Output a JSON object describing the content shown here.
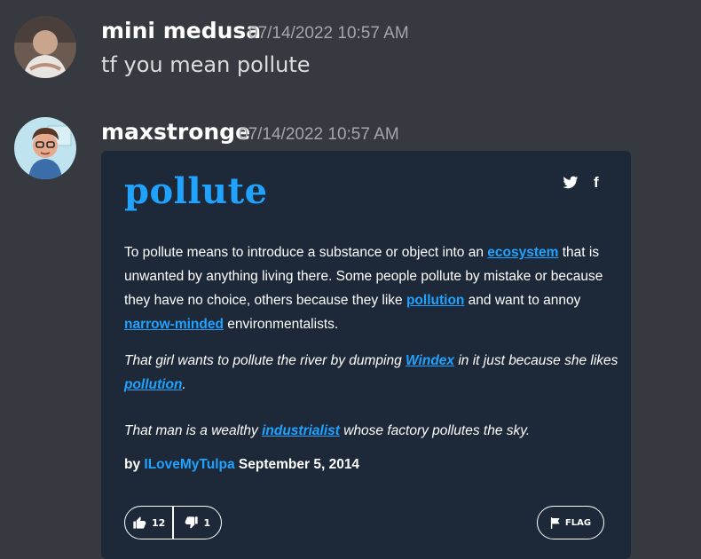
{
  "messages": [
    {
      "username": "mini medusa",
      "timestamp": "07/14/2022 10:57 AM",
      "text": "tf you mean pollute"
    },
    {
      "username": "maxstronge",
      "timestamp": "07/14/2022 10:57 AM"
    }
  ],
  "embed": {
    "word": "pollute",
    "share": {
      "twitter": "twitter-icon",
      "facebook": "f"
    },
    "definition": {
      "p1": "To pollute means to introduce a substance or object into an ",
      "l1": "ecosystem",
      "p2": " that is unwanted by anything living there. Some people pollute by mistake or because they have no choice, others because they like ",
      "l2": "pollution",
      "p3": " and want to annoy ",
      "l3": "narrow-minded",
      "p4": " environmentalists."
    },
    "example1": {
      "p1": "That girl wants to pollute the river by dumping ",
      "l1": "Windex",
      "p2": " in it just because she likes ",
      "l2": "pollution",
      "p3": "."
    },
    "example2": {
      "p1": "That man is a wealthy ",
      "l1": "industrialist",
      "p2": " whose factory pollutes the sky."
    },
    "byline": {
      "by": "by",
      "author": "ILoveMyTulpa",
      "date": "September 5, 2014"
    },
    "votes": {
      "up": "12",
      "down": "1"
    },
    "flag_label": "FLAG"
  },
  "colors": {
    "background": "#36393f",
    "embed": "#1d2939",
    "link": "#1fa3ff"
  }
}
